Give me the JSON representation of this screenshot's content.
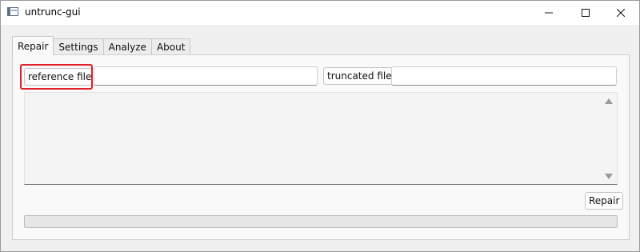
{
  "window": {
    "title": "untrunc-gui"
  },
  "icons": {
    "app": "app-window-icon",
    "minimize": "minimize-icon",
    "maximize": "maximize-icon",
    "close": "close-icon",
    "scroll_up": "scroll-up-arrow-icon",
    "scroll_down": "scroll-down-arrow-icon"
  },
  "tabs": [
    {
      "label": "Repair",
      "active": true
    },
    {
      "label": "Settings",
      "active": false
    },
    {
      "label": "Analyze",
      "active": false
    },
    {
      "label": "About",
      "active": false
    }
  ],
  "repair": {
    "reference_button": "reference file",
    "reference_path": "",
    "truncated_button": "truncated file",
    "truncated_path": "",
    "log": "",
    "repair_button": "Repair",
    "progress": 0
  },
  "colors": {
    "highlight": "#e0202a",
    "progress_fill": "#3c8fd8"
  }
}
